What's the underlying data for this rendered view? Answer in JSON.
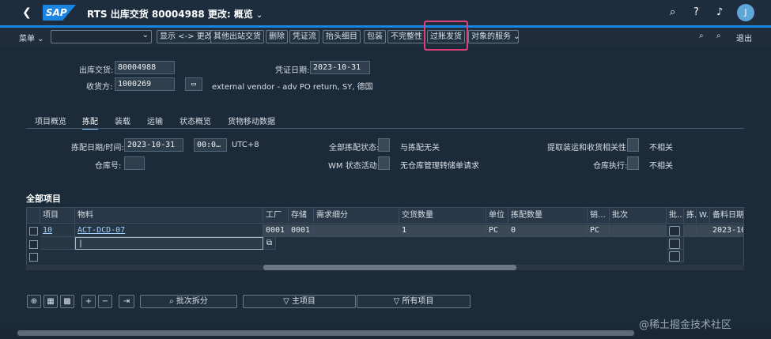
{
  "shell": {
    "back_icon": "chevron-left-icon",
    "logo": "SAP",
    "title": "RTS 出库交货 80004988 更改: 概览",
    "avatar": "J"
  },
  "toolbar": {
    "menu": "菜单",
    "buttons": [
      "显示 <-> 更改",
      "其他出站交货",
      "删除",
      "凭证流",
      "抬头细目",
      "包装",
      "不完整性",
      "过账发货",
      "对象的服务"
    ],
    "exit": "退出"
  },
  "header": {
    "delivery_label": "出库交货:",
    "delivery_value": "80004988",
    "doc_date_label": "凭证日期:",
    "doc_date_value": "2023-10-31",
    "ship_to_label": "收货方:",
    "ship_to_value": "1000269",
    "ship_to_desc": "external vendor - adv PO return, SY, 德国"
  },
  "tabs": [
    "项目概览",
    "拣配",
    "装载",
    "运输",
    "状态概览",
    "货物移动数据"
  ],
  "pick": {
    "pick_date_label": "拣配日期/时间:",
    "pick_date_value": "2023-10-31",
    "pick_time_value": "00:0…",
    "tz": "UTC+8",
    "overall_label": "全部拣配状态:",
    "overall_text": "与拣配无关",
    "wm_label": "WM 状态活动:",
    "wm_text": "无仓库管理转储单请求",
    "warehouse_label": "仓库号:",
    "relevance_label": "提取装运和收货相关性:",
    "relevance_text": "不相关",
    "wh_exec_label": "仓库执行:",
    "wh_exec_text": "不相关"
  },
  "items_title": "全部项目",
  "columns": [
    "项目",
    "物料",
    "工厂",
    "存储",
    "需求细分",
    "交货数量",
    "单位",
    "拣配数量",
    "销…",
    "批次",
    "批…",
    "拣.",
    "W.",
    "备料日期"
  ],
  "row1": {
    "item": "10",
    "material": "ACT-DCD-07",
    "plant": "0001",
    "sloc": "0001",
    "qty": "1",
    "unit": "PC",
    "pick_qty": "0",
    "sales_unit": "PC",
    "date": "2023-10"
  },
  "bottom": {
    "split_label": "批次拆分",
    "main_item_label": "主项目",
    "all_items_label": "所有项目"
  },
  "watermark": "@稀土掘金技术社区"
}
